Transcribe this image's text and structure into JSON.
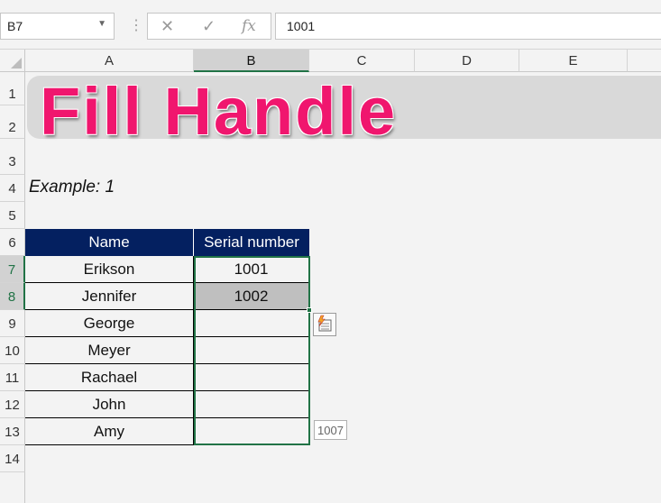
{
  "name_box": "B7",
  "formula_bar": {
    "cancel_icon": "✕",
    "enter_icon": "✓",
    "fx_label": "fx",
    "value": "1001"
  },
  "columns": [
    "A",
    "B",
    "C",
    "D",
    "E"
  ],
  "selected_column": "B",
  "rows": [
    "1",
    "2",
    "3",
    "4",
    "5",
    "6",
    "7",
    "8",
    "9",
    "10",
    "11",
    "12",
    "13",
    "14"
  ],
  "title": "Fill Handle",
  "example_label": "Example: 1",
  "table": {
    "headers": [
      "Name",
      "Serial number"
    ],
    "rows": [
      {
        "name": "Erikson",
        "serial": "1001"
      },
      {
        "name": "Jennifer",
        "serial": "1002"
      },
      {
        "name": "George",
        "serial": ""
      },
      {
        "name": "Meyer",
        "serial": ""
      },
      {
        "name": "Rachael",
        "serial": ""
      },
      {
        "name": "John",
        "serial": ""
      },
      {
        "name": "Amy",
        "serial": ""
      }
    ]
  },
  "fill_tooltip": "1007",
  "colors": {
    "accent": "#217346",
    "header_bg": "#042060",
    "title": "#f0166e"
  }
}
